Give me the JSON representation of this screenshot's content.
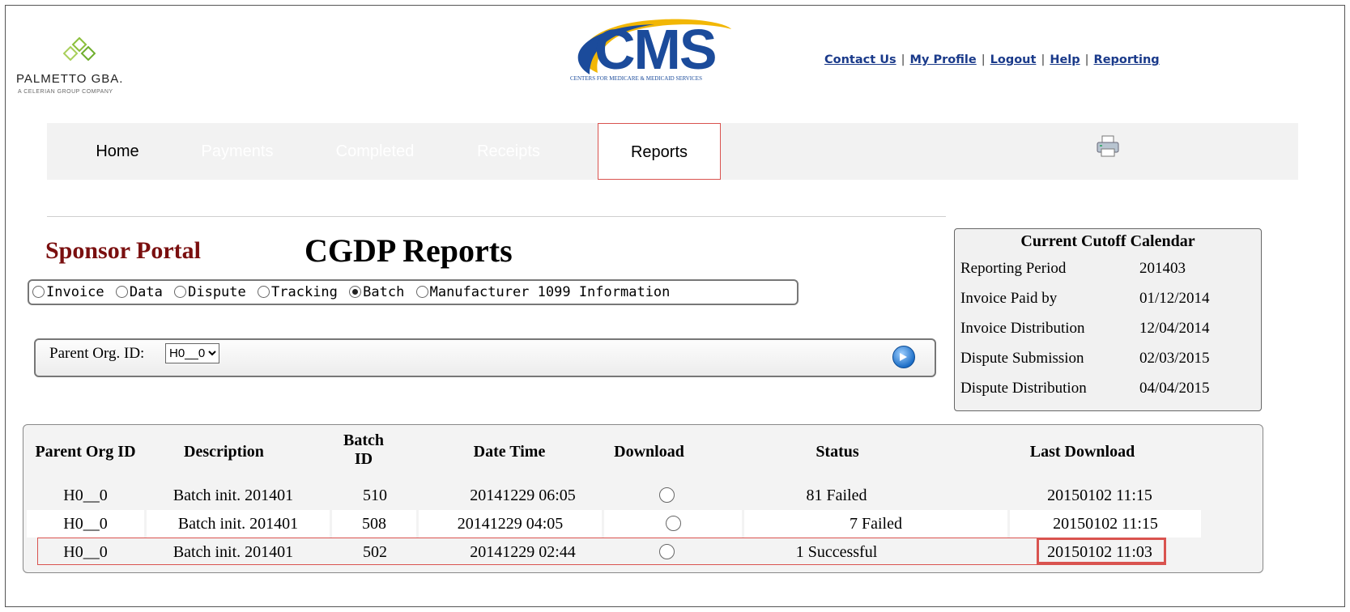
{
  "header": {
    "palmetto_name": "PALMETTO GBA.",
    "palmetto_tag": "A CELERIAN GROUP COMPANY",
    "cms_word": "CMS",
    "cms_sub": "CENTERS FOR MEDICARE & MEDICAID SERVICES",
    "links": [
      "Contact Us",
      "My Profile",
      "Logout",
      "Help",
      "Reporting"
    ],
    "link_separator": "|"
  },
  "nav": {
    "items": [
      "Home",
      "Payments",
      "Completed",
      "Receipts",
      "Reports"
    ],
    "active": "Reports"
  },
  "page": {
    "portal_title": "Sponsor Portal",
    "title": "CGDP Reports"
  },
  "report_types": [
    {
      "label": "Invoice",
      "selected": false
    },
    {
      "label": "Data",
      "selected": false
    },
    {
      "label": "Dispute",
      "selected": false
    },
    {
      "label": "Tracking",
      "selected": false
    },
    {
      "label": "Batch",
      "selected": true
    },
    {
      "label": "Manufacturer 1099 Information",
      "selected": false
    }
  ],
  "filter": {
    "label": "Parent Org. ID:",
    "selected_value": "H0__0"
  },
  "calendar": {
    "title": "Current Cutoff Calendar",
    "rows": [
      {
        "label": "Reporting Period",
        "value": "201403"
      },
      {
        "label": "Invoice Paid by",
        "value": "01/12/2014"
      },
      {
        "label": "Invoice Distribution",
        "value": "12/04/2014"
      },
      {
        "label": "Dispute Submission",
        "value": "02/03/2015"
      },
      {
        "label": "Dispute Distribution",
        "value": "04/04/2015"
      }
    ]
  },
  "table": {
    "headers": {
      "parent_org_id": "Parent Org ID",
      "description": "Description",
      "batch_id_1": "Batch",
      "batch_id_2": "ID",
      "date_time": "Date Time",
      "download": "Download",
      "status": "Status",
      "last_download": "Last Download"
    },
    "rows": [
      {
        "org": "H0__0",
        "description": "Batch init. 201401",
        "batch_id": "510",
        "date_time": "20141229 06:05",
        "status": "81 Failed",
        "last_download": "20150102 11:15"
      },
      {
        "org": "H0__0",
        "description": "Batch init. 201401",
        "batch_id": "508",
        "date_time": "20141229 04:05",
        "status": "7 Failed",
        "last_download": "20150102 11:15"
      },
      {
        "org": "H0__0",
        "description": "Batch init. 201401",
        "batch_id": "502",
        "date_time": "20141229 02:44",
        "status": "1 Successful",
        "last_download": "20150102 11:03"
      }
    ]
  },
  "colors": {
    "link": "#1a3a8a",
    "highlight": "#d9534f",
    "portal_title": "#7a0f0f",
    "cms_blue": "#1b4b9b"
  }
}
